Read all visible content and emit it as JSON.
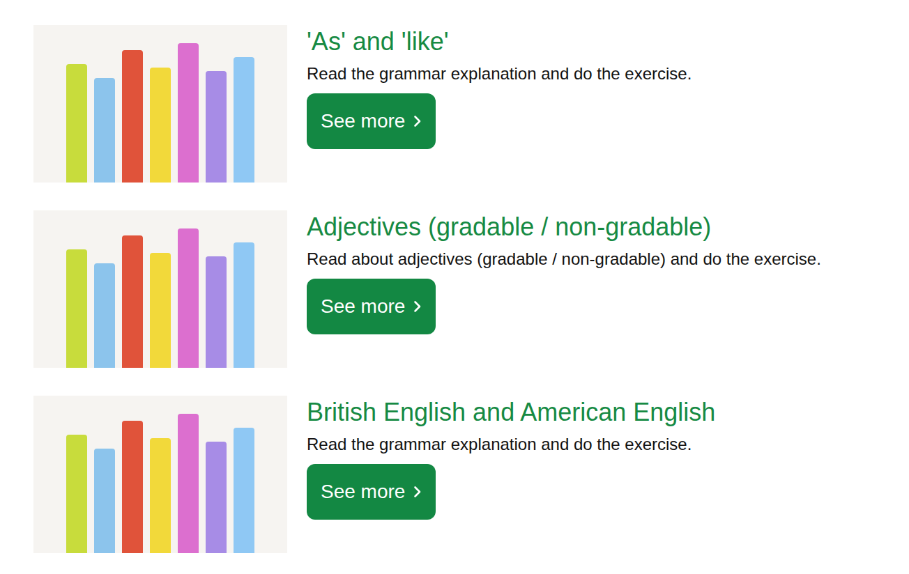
{
  "items": [
    {
      "title": "'As' and 'like'",
      "description": "Read the grammar explanation and do the exercise.",
      "button": "See more"
    },
    {
      "title": "Adjectives (gradable / non-gradable)",
      "description": "Read about adjectives (gradable / non-gradable) and do the exercise.",
      "button": "See more"
    },
    {
      "title": "British English and American English",
      "description": "Read the grammar explanation and do the exercise.",
      "button": "See more"
    }
  ]
}
